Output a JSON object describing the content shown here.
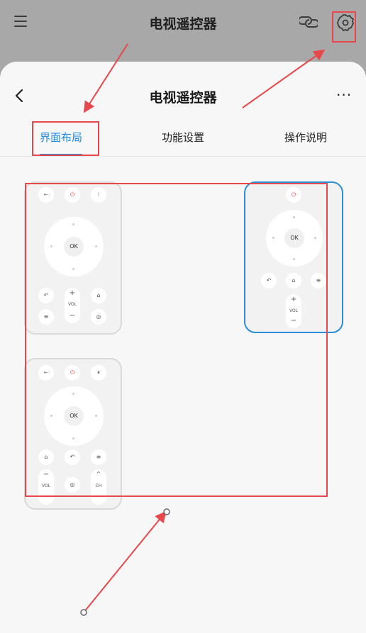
{
  "background_app": {
    "title": "电视遥控器",
    "icons": [
      "menu-icon",
      "link-icon",
      "gear-icon"
    ]
  },
  "sheet": {
    "title": "电视遥控器",
    "more_label": "···",
    "tabs": [
      {
        "label": "界面布局",
        "active": true
      },
      {
        "label": "功能设置",
        "active": false
      },
      {
        "label": "操作说明",
        "active": false
      }
    ]
  },
  "remotes": [
    {
      "selected": false,
      "top_buttons": [
        "input-icon",
        "power-icon",
        "menu-icon"
      ],
      "ok_label": "OK",
      "bottom_buttons": [
        "back-icon",
        "home-icon",
        "menu-lines-icon",
        "apps-icon"
      ],
      "volume": {
        "plus": "+",
        "label": "VOL",
        "minus": "−"
      }
    },
    {
      "selected": true,
      "top_buttons": [
        "power-icon"
      ],
      "ok_label": "OK",
      "bottom_buttons": [
        "back-icon",
        "home-icon",
        "menu-lines-icon"
      ],
      "volume": {
        "plus": "+",
        "label": "VOL",
        "minus": "−"
      }
    },
    {
      "selected": false,
      "top_buttons": [
        "input-icon",
        "power-icon",
        "pause-icon"
      ],
      "ok_label": "OK",
      "bottom_buttons": [
        "home-icon",
        "back-icon",
        "menu-lines-icon",
        "apps-icon"
      ],
      "volume": {
        "plus": "+",
        "label": "VOL",
        "minus": "−"
      },
      "channel": {
        "up": "^",
        "label": "CH",
        "down": "v"
      }
    }
  ],
  "colors": {
    "accent": "#1e88e5",
    "annotation": "#e8474b",
    "selected_border": "#2b8fd8",
    "power": "#e53935"
  }
}
